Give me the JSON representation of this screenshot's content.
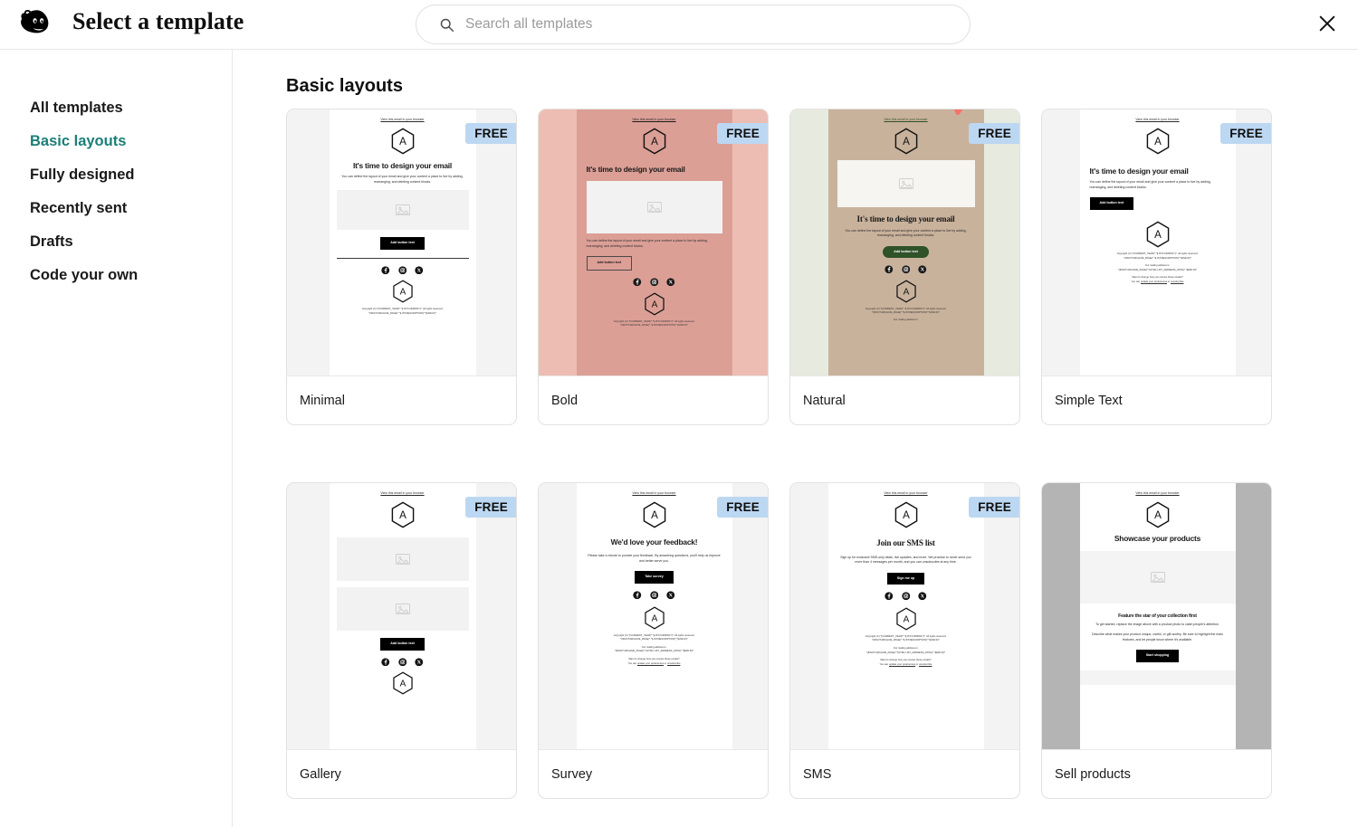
{
  "header": {
    "title": "Select a template",
    "logo_icon": "mailchimp-freddie-logo",
    "close_icon": "close-icon",
    "search": {
      "icon": "search-icon",
      "placeholder": "Search all templates",
      "value": ""
    }
  },
  "sidebar": {
    "items": [
      {
        "label": "All templates",
        "active": false
      },
      {
        "label": "Basic layouts",
        "active": true
      },
      {
        "label": "Fully designed",
        "active": false
      },
      {
        "label": "Recently sent",
        "active": false
      },
      {
        "label": "Drafts",
        "active": false
      },
      {
        "label": "Code your own",
        "active": false
      }
    ]
  },
  "main": {
    "section_title": "Basic layouts",
    "badge_label": "FREE",
    "cursor_annotation": {
      "visible": true,
      "color": "#f4736a",
      "target_card": "Natural"
    },
    "common": {
      "browser_link": "View this email in your browser",
      "heading": "It's time to design your email",
      "body": "You can define the layout of your email and give your content a place to live by adding, rearranging, and deleting content blocks.",
      "button": "Add button text",
      "copyright_1": "Copyright (C) *|CURRENT_YEAR|* *|LIST:COMPANY|*. All rights reserved.",
      "copyright_2": "*|IFNOT:ARCHIVE_PAGE|* *|LIST:DESCRIPTION|* *|END:IF|*",
      "mailing_label": "Our mailing address is:",
      "mailing_addr": "*|IFNOT:ARCHIVE_PAGE|* *|HTML:LIST_ADDRESS_HTML|* *|END:IF|*",
      "prefs_q": "Want to change how you receive these emails?",
      "prefs_a_pre": "You can ",
      "prefs_a_link1": "update your preferences",
      "prefs_a_mid": " or ",
      "prefs_a_link2": "unsubscribe",
      "social_icons": [
        "facebook-icon",
        "instagram-icon",
        "x-twitter-icon"
      ],
      "logo_icon": "hexagon-a-logo",
      "image_placeholder_icon": "image-placeholder-icon"
    },
    "templates": [
      {
        "name": "Minimal",
        "free": true,
        "style": "minimal",
        "page_bg": "#f3f3f3",
        "body_bg": "#ffffff",
        "accent": "#000000"
      },
      {
        "name": "Bold",
        "free": true,
        "style": "bold",
        "page_bg": "#edbdb4",
        "body_bg": "#dc9f96",
        "accent": "#1a1a1a"
      },
      {
        "name": "Natural",
        "free": true,
        "style": "natural",
        "page_bg": "#e7eade",
        "body_bg": "#c9b29c",
        "accent": "#2f5228",
        "has_cursor": true
      },
      {
        "name": "Simple Text",
        "free": true,
        "style": "simple-text",
        "page_bg": "#f3f3f3",
        "body_bg": "#ffffff",
        "accent": "#000000"
      },
      {
        "name": "Gallery",
        "free": true,
        "style": "gallery",
        "page_bg": "#f3f3f3",
        "body_bg": "#ffffff",
        "accent": "#000000"
      },
      {
        "name": "Survey",
        "free": true,
        "style": "survey",
        "page_bg": "#f3f3f3",
        "body_bg": "#ffffff",
        "accent": "#000000",
        "heading": "We'd love your feedback!",
        "body": "Please take a minute to provide your feedback. By answering questions, you'll help us improve and better serve you.",
        "button": "Take survey"
      },
      {
        "name": "SMS",
        "free": true,
        "style": "sms",
        "page_bg": "#f3f3f3",
        "body_bg": "#ffffff",
        "accent": "#000000",
        "heading": "Join our SMS list",
        "body": "Sign up for exclusive SMS-only deals, live updates, and more. We promise to never send you more than 4 messages per month, and you can unsubscribe at any time.",
        "button": "Sign me up"
      },
      {
        "name": "Sell products",
        "free": false,
        "style": "sell-products",
        "page_bg": "#b4b4b4",
        "body_bg": "#ffffff",
        "accent": "#000000",
        "heading": "Showcase your products",
        "subheading": "Feature the star of your collection first",
        "body": "To get started, replace the image above with a product photo to catch people's attention.",
        "body2": "Describe what makes your product unique, useful, or gift-worthy. Be sure to highlight the main features, and let people know where it's available.",
        "button": "Start shopping"
      }
    ]
  }
}
